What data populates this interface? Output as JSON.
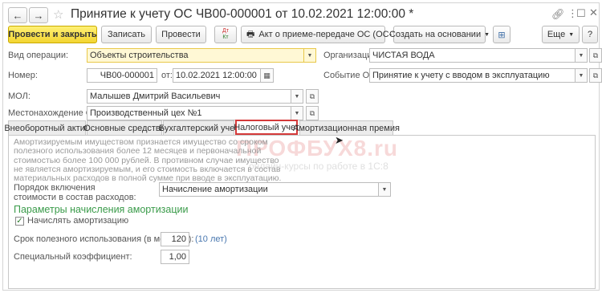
{
  "window": {
    "title": "Принятие к учету ОС ЧВ00-000001 от 10.02.2021 12:00:00 *"
  },
  "toolbar": {
    "post_close": "Провести и закрыть",
    "save": "Записать",
    "post": "Провести",
    "dtkt_top": "Дт",
    "dtkt_bottom": "Кт",
    "act": "Акт о приеме-передаче ОС (ОС-1)",
    "create_based": "Создать на основании",
    "more": "Еще",
    "help": "?"
  },
  "form": {
    "op_type_label": "Вид операции:",
    "op_type_value": "Объекты строительства",
    "org_label": "Организация:",
    "org_value": "ЧИСТАЯ ВОДА",
    "number_label": "Номер:",
    "number_value": "ЧВ00-000001",
    "date_label": "от:",
    "date_value": "10.02.2021 12:00:00",
    "event_label": "Событие ОС:",
    "event_value": "Принятие к учету с вводом в эксплуатацию",
    "mol_label": "МОЛ:",
    "mol_value": "Малышев  Дмитрий  Васильевич",
    "location_label": "Местонахождение ОС:",
    "location_value": "Производственный цех №1"
  },
  "tabs": [
    {
      "label": "Внеоборотный актив"
    },
    {
      "label": "Основные средства"
    },
    {
      "label": "Бухгалтерский учет"
    },
    {
      "label": "Налоговый учет"
    },
    {
      "label": "Амортизационная премия"
    }
  ],
  "tax": {
    "info_lines": [
      "Амортизируемым имуществом признается имущество со сроком",
      "полезного использования более 12 месяцев и первоначальной",
      "стоимостью более 100 000 рублей. В противном случае имущество",
      "не является амортизируемым, и его стоимость включается в состав",
      "материальных расходов в полной сумме при вводе в эксплуатацию."
    ],
    "expense_label_1": "Порядок включения",
    "expense_label_2": "стоимости в состав расходов:",
    "expense_value": "Начисление амортизации",
    "section_title": "Параметры начисления амортизации",
    "accrue_label": "Начислять амортизацию",
    "accrue_mark": "✓",
    "life_label": "Срок полезного использования (в месяцах):",
    "life_value": "120",
    "life_years": "(10 лет)",
    "coef_label": "Специальный коэффициент:",
    "coef_value": "1,00"
  },
  "watermark": {
    "brand": "ПРОФБУХ8.ru",
    "tagline": "онлайн-курсы по работе в 1С:8"
  },
  "colors": {
    "primary_button": "#f3d531",
    "active_tab_border": "#d43a3a",
    "section_title": "#3a9b4a",
    "highlight_field": "#fff8d5"
  }
}
